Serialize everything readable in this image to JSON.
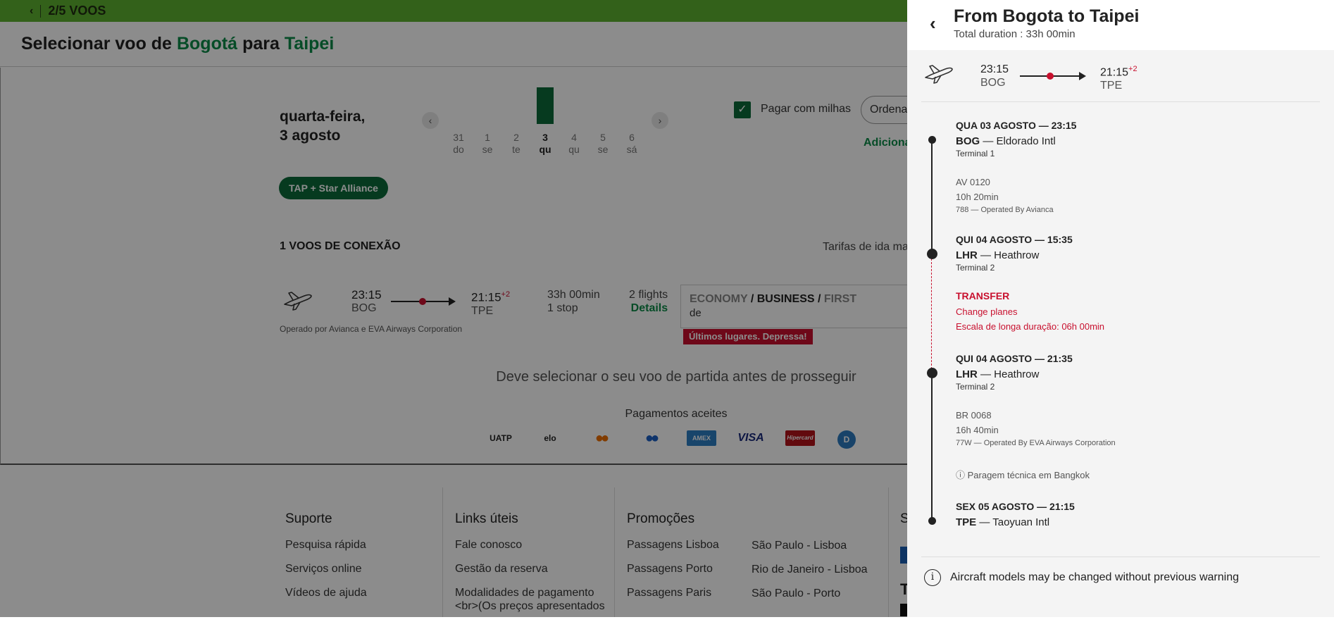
{
  "topbar": {
    "back": "‹",
    "steps": "2/5 VOOS"
  },
  "page_title": {
    "prefix": "Selecionar voo de",
    "origin": "Bogotá",
    "mid": "para",
    "destination": "Taipei"
  },
  "date": {
    "line1": "quarta-feira,",
    "line2": "3 agosto"
  },
  "calendar": {
    "prev": "‹",
    "next": "›",
    "days": [
      {
        "n": "31",
        "d": "do"
      },
      {
        "n": "1",
        "d": "se"
      },
      {
        "n": "2",
        "d": "te"
      },
      {
        "n": "3",
        "d": "qu"
      },
      {
        "n": "4",
        "d": "qu"
      },
      {
        "n": "5",
        "d": "se"
      },
      {
        "n": "6",
        "d": "sá"
      }
    ]
  },
  "options": {
    "check": "✓",
    "pay_miles": "Pagar com milhas",
    "order": "Ordena",
    "additional": "Adiciona"
  },
  "alliance": "TAP + Star Alliance",
  "results": {
    "title": "1 VOOS DE CONEXÃO",
    "tarifas": "Tarifas de ida mai",
    "dep_time": "23:15",
    "dep_code": "BOG",
    "arr_time": "21:15",
    "arr_plus": "+2",
    "arr_code": "TPE",
    "duration": "33h 00min",
    "stops": "1 stop",
    "flights": "2 flights",
    "details": "Details",
    "operated": "Operado por Avianca e EVA Airways Corporation",
    "cabin_economy": "ECONOMY",
    "cabin_slash1": " / ",
    "cabin_business": "BUSINESS",
    "cabin_slash2": " / ",
    "cabin_first": "FIRST",
    "de": "de",
    "last_seats": "Últimos lugares. Depressa!"
  },
  "notice": "Deve selecionar o seu voo de partida antes de prosseguir",
  "payments": {
    "title": "Pagamentos aceites",
    "logos": [
      "UATP",
      "elo",
      "●●",
      "●●",
      "AMEX",
      "VISA",
      "Hipercard",
      "D"
    ]
  },
  "footer": {
    "support": {
      "title": "Suporte",
      "links": [
        "Pesquisa rápida",
        "Serviços online",
        "Vídeos de ajuda"
      ]
    },
    "useful": {
      "title": "Links úteis",
      "links": [
        "Fale conosco",
        "Gestão da reserva",
        "Modalidades de pagamento <br>(Os preços apresentados"
      ]
    },
    "promos": {
      "title": "Promoções",
      "col1": [
        "Passagens Lisboa",
        "Passagens Porto",
        "Passagens Paris"
      ],
      "col2": [
        "São Paulo - Lisboa",
        "Rio de Janeiro - Lisboa",
        "São Paulo - Porto"
      ]
    },
    "cut": {
      "s": "S",
      "t": "T"
    }
  },
  "panel": {
    "back": "‹",
    "title": "From Bogota to Taipei",
    "subtitle": "Total duration : 33h 00min",
    "summary": {
      "dep_time": "23:15",
      "dep_code": "BOG",
      "arr_time": "21:15",
      "arr_plus": "+2",
      "arr_code": "TPE"
    },
    "stops": [
      {
        "date": "QUA 03 AGOSTO — 23:15",
        "code": "BOG",
        "name": " — Eldorado Intl",
        "terminal": "Terminal 1"
      },
      {
        "date": "QUI 04 AGOSTO — 15:35",
        "code": "LHR",
        "name": " — Heathrow",
        "terminal": "Terminal 2"
      },
      {
        "date": "QUI 04 AGOSTO — 21:35",
        "code": "LHR",
        "name": " — Heathrow",
        "terminal": "Terminal 2"
      },
      {
        "date": "SEX 05 AGOSTO — 21:15",
        "code": "TPE",
        "name": " — Taoyuan Intl"
      }
    ],
    "segments": [
      {
        "flight": "AV 0120",
        "duration": "10h 20min",
        "aircraft": "788 — Operated By Avianca"
      },
      {
        "flight": "BR 0068",
        "duration": "16h 40min",
        "aircraft": "77W — Operated By EVA Airways Corporation"
      }
    ],
    "transfer": {
      "title": "TRANSFER",
      "change": "Change planes",
      "long": "Escala de longa duração: 06h 00min"
    },
    "tech_stop": "ⓘ Paragem técnica em Bangkok",
    "warning_icon": "i",
    "warning": "Aircraft models may be changed without previous warning"
  },
  "colors": {
    "brand_green": "#5eb130",
    "dark_green": "#0b6b3a",
    "accent_red": "#c8102e"
  }
}
